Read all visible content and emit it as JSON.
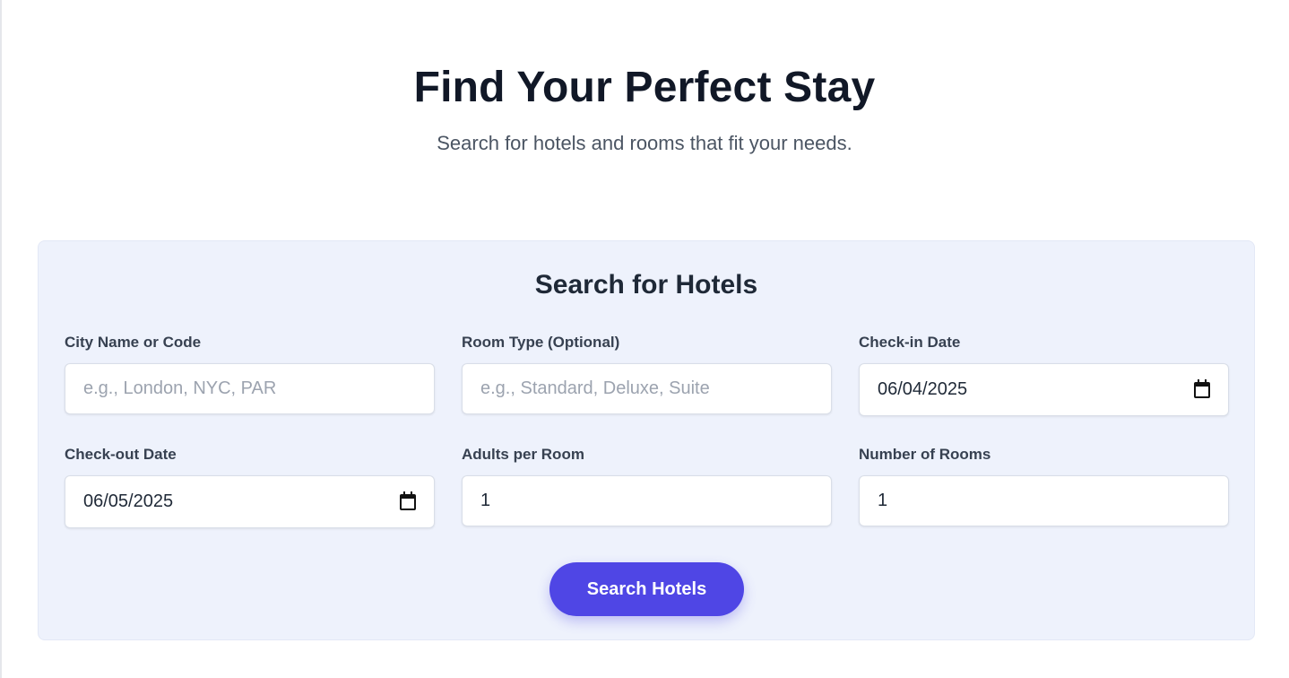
{
  "hero": {
    "title": "Find Your Perfect Stay",
    "subtitle": "Search for hotels and rooms that fit your needs."
  },
  "search_form": {
    "heading": "Search for Hotels",
    "fields": {
      "city": {
        "label": "City Name or Code",
        "value": "",
        "placeholder": "e.g., London, NYC, PAR"
      },
      "room_type": {
        "label": "Room Type (Optional)",
        "value": "",
        "placeholder": "e.g., Standard, Deluxe, Suite"
      },
      "check_in": {
        "label": "Check-in Date",
        "value": "06/04/2025",
        "icon": "calendar-icon"
      },
      "check_out": {
        "label": "Check-out Date",
        "value": "06/05/2025",
        "icon": "calendar-icon"
      },
      "adults": {
        "label": "Adults per Room",
        "value": "1"
      },
      "rooms": {
        "label": "Number of Rooms",
        "value": "1"
      }
    },
    "submit_label": "Search Hotels"
  },
  "colors": {
    "accent": "#4f46e5",
    "card_background": "#eef2fc",
    "heading": "#111827",
    "muted_text": "#4b5563",
    "placeholder": "#9ca3af"
  }
}
